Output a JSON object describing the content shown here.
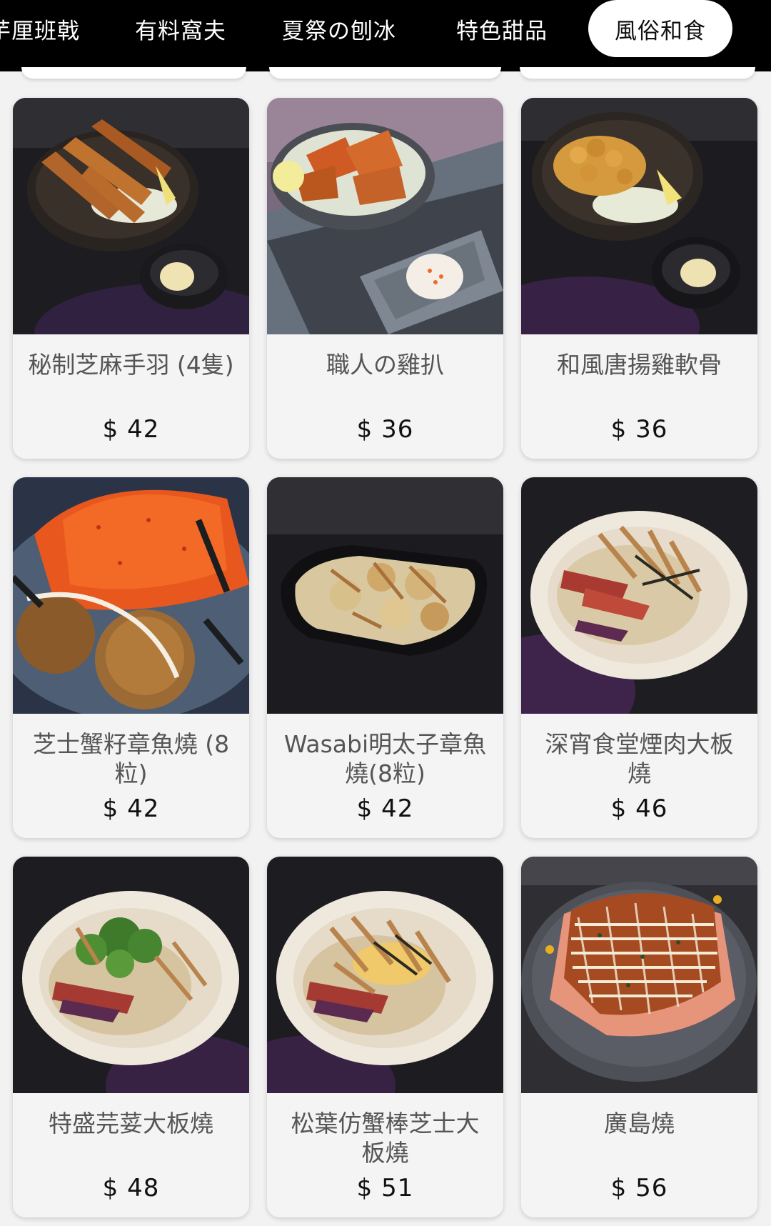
{
  "category_tabs": [
    {
      "label": "芋厘班戟",
      "active": false
    },
    {
      "label": "有料窩夫",
      "active": false
    },
    {
      "label": "夏祭の刨冰",
      "active": false
    },
    {
      "label": "特色甜品",
      "active": false
    },
    {
      "label": "風俗和食",
      "active": true
    }
  ],
  "menu_items": [
    {
      "name": "秘制芝麻手羽 (4隻)",
      "price": "$ 42"
    },
    {
      "name": "職人の雞扒",
      "price": "$ 36"
    },
    {
      "name": "和風唐揚雞軟骨",
      "price": "$ 36"
    },
    {
      "name": "芝士蟹籽章魚燒 (8粒)",
      "price": "$ 42"
    },
    {
      "name": "Wasabi明太子章魚燒(8粒)",
      "price": "$ 42"
    },
    {
      "name": "深宵食堂煙肉大板燒",
      "price": "$ 46"
    },
    {
      "name": "特盛芫荽大板燒",
      "price": "$ 48"
    },
    {
      "name": "松葉仿蟹棒芝士大板燒",
      "price": "$ 51"
    },
    {
      "name": "廣島燒",
      "price": "$ 56"
    }
  ],
  "colors": {
    "header_bg": "#000000",
    "active_tab_bg": "#ffffff",
    "page_bg": "#f2f2f2",
    "card_bg": "#f4f4f4"
  }
}
